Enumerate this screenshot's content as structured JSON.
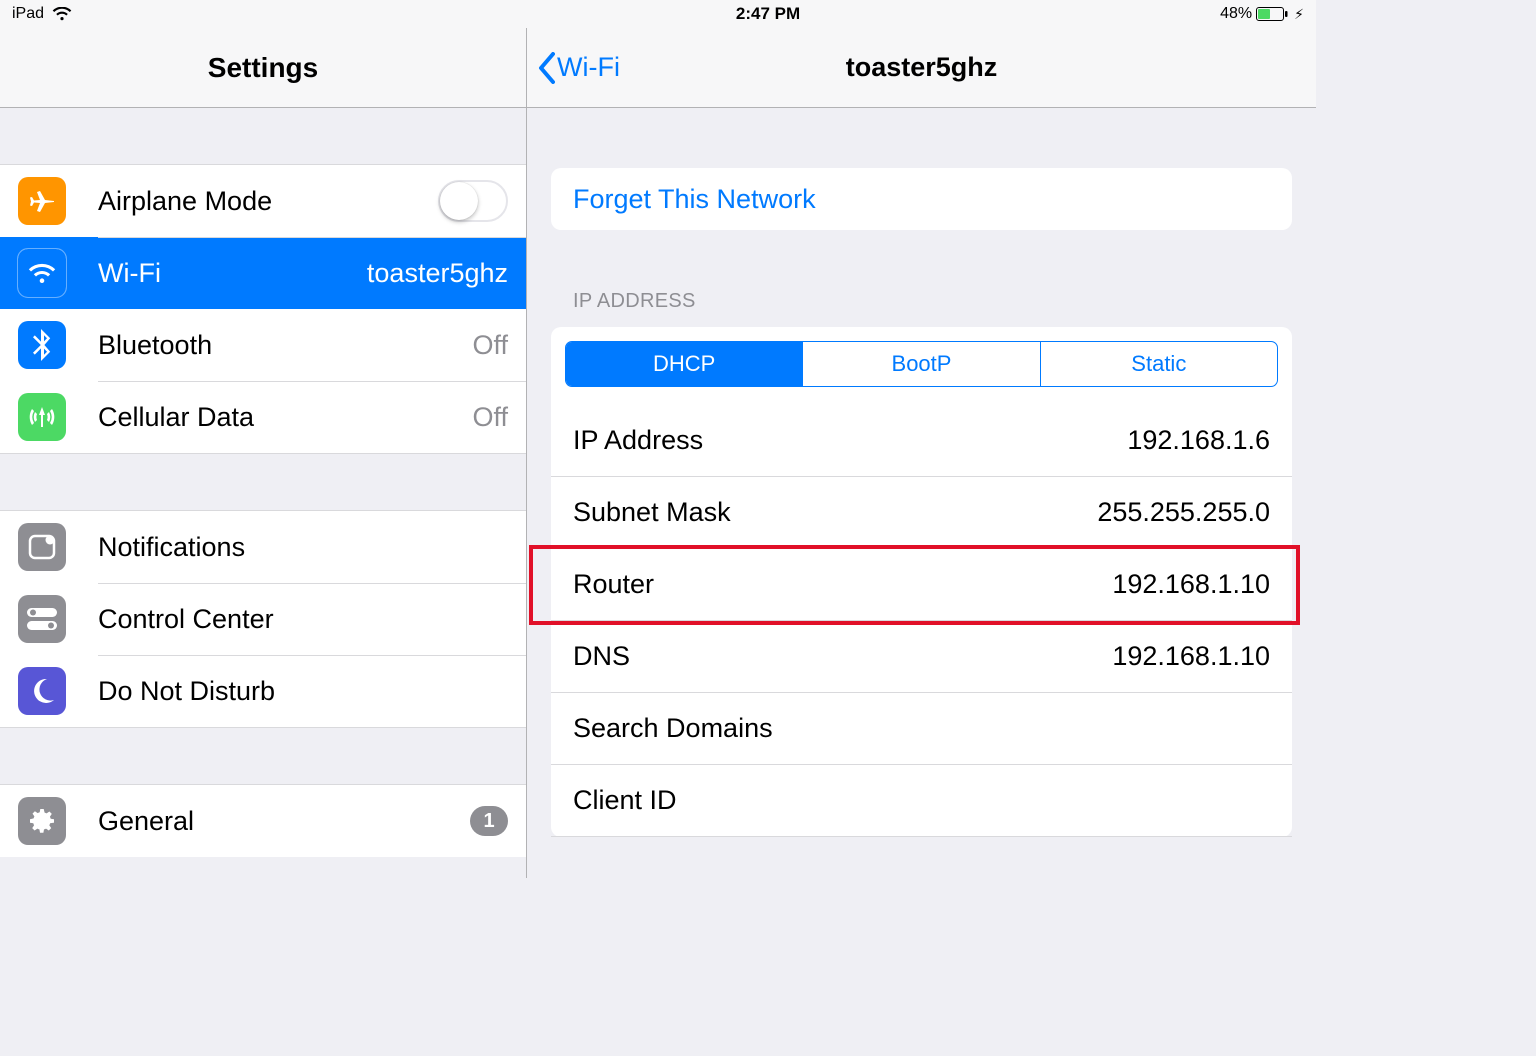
{
  "statusbar": {
    "device": "iPad",
    "time": "2:47 PM",
    "battery_pct": "48%"
  },
  "sidebar": {
    "title": "Settings",
    "group1": [
      {
        "id": "airplane",
        "label": "Airplane Mode"
      },
      {
        "id": "wifi",
        "label": "Wi-Fi",
        "value": "toaster5ghz"
      },
      {
        "id": "bluetooth",
        "label": "Bluetooth",
        "value": "Off"
      },
      {
        "id": "cellular",
        "label": "Cellular Data",
        "value": "Off"
      }
    ],
    "group2": [
      {
        "id": "notifications",
        "label": "Notifications"
      },
      {
        "id": "controlcenter",
        "label": "Control Center"
      },
      {
        "id": "dnd",
        "label": "Do Not Disturb"
      }
    ],
    "group3": [
      {
        "id": "general",
        "label": "General",
        "badge": "1"
      }
    ]
  },
  "detail": {
    "back_label": "Wi-Fi",
    "title": "toaster5ghz",
    "forget_label": "Forget This Network",
    "section_label": "IP ADDRESS",
    "segments": [
      "DHCP",
      "BootP",
      "Static"
    ],
    "segment_active": 0,
    "rows": [
      {
        "label": "IP Address",
        "value": "192.168.1.6"
      },
      {
        "label": "Subnet Mask",
        "value": "255.255.255.0"
      },
      {
        "label": "Router",
        "value": "192.168.1.10",
        "highlight": true
      },
      {
        "label": "DNS",
        "value": "192.168.1.10"
      },
      {
        "label": "Search Domains",
        "value": ""
      },
      {
        "label": "Client ID",
        "value": ""
      }
    ]
  }
}
